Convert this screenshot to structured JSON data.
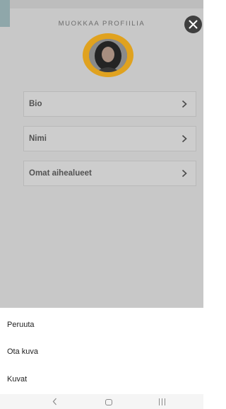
{
  "profile": {
    "title": "MUOKKAA PROFIILIA",
    "items": [
      {
        "label": "Bio"
      },
      {
        "label": "Nimi"
      },
      {
        "label": "Omat aihealueet"
      }
    ]
  },
  "sheet": {
    "options": [
      {
        "label": "Peruuta"
      },
      {
        "label": "Ota kuva"
      },
      {
        "label": "Kuvat"
      }
    ]
  },
  "icons": {
    "close": "close-icon",
    "chevron": "chevron-right-icon",
    "nav_back": "back-icon",
    "nav_home": "home-icon",
    "nav_recent": "recent-apps-icon"
  },
  "colors": {
    "accent_ring": "#e0a21f",
    "overlay": "#c8c8c8",
    "close_button": "#3f3f3f"
  }
}
